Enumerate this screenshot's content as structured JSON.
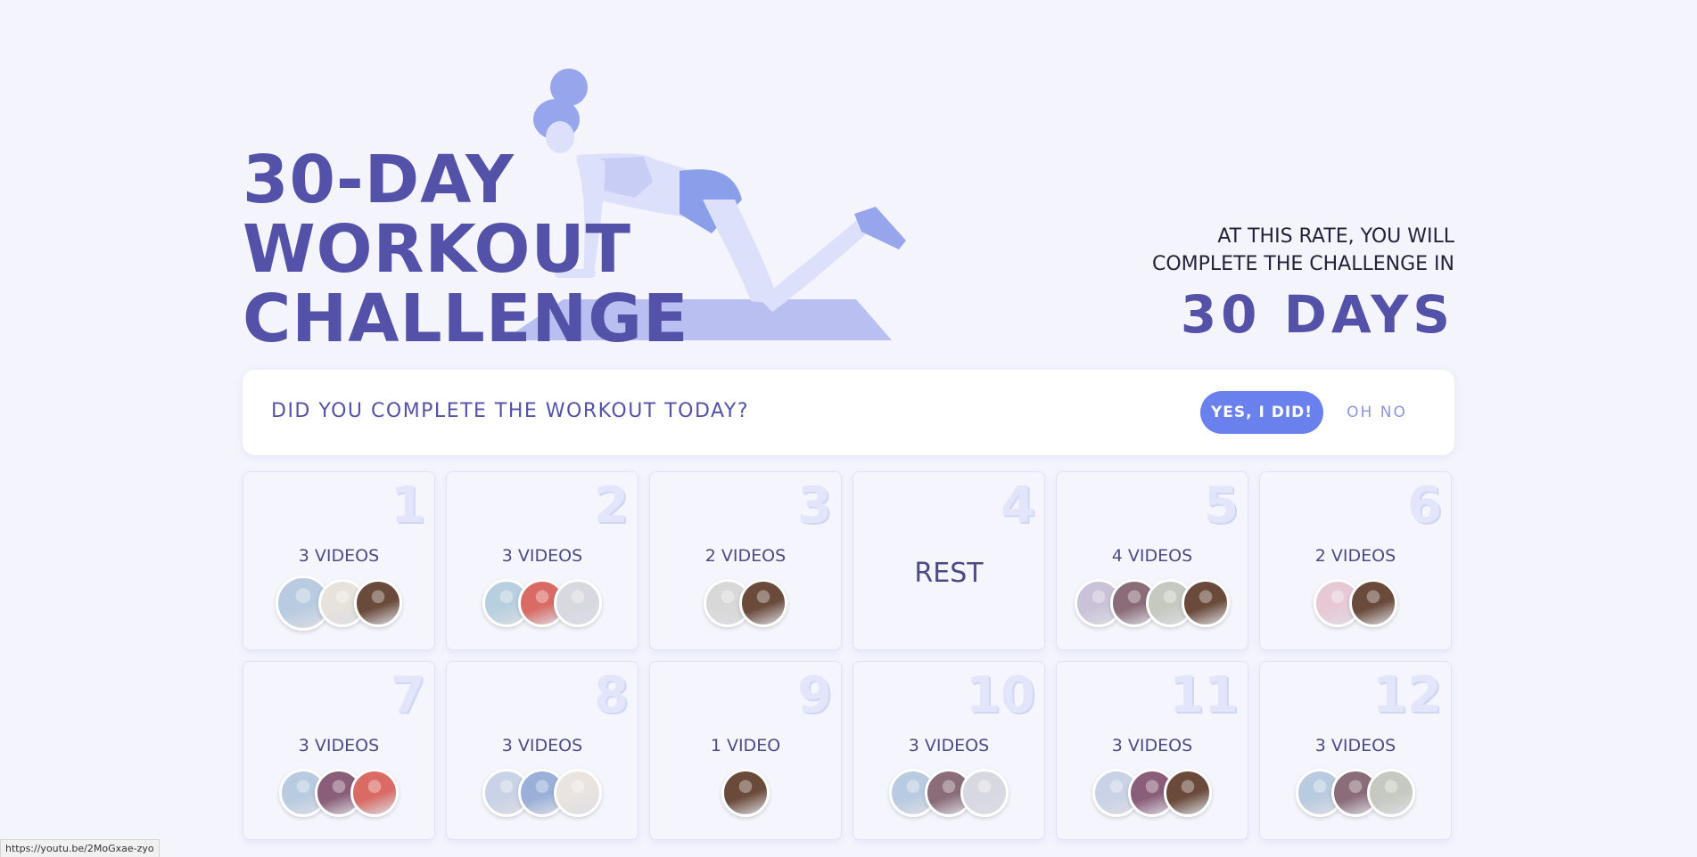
{
  "hero": {
    "title_lines": [
      "30-DAY",
      "WORKOUT",
      "CHALLENGE"
    ],
    "rate_line1": "AT THIS RATE, YOU WILL",
    "rate_line2": "COMPLETE THE CHALLENGE IN",
    "rate_days": "30 DAYS"
  },
  "question": {
    "text": "DID YOU COMPLETE THE WORKOUT TODAY?",
    "yes_label": "YES, I DID!",
    "no_label": "OH NO"
  },
  "days": [
    {
      "num": "1",
      "label": "3 VIDEOS",
      "thumbs": [
        "#b9cbe0",
        "#e8e2dc",
        "#6a4a3a"
      ]
    },
    {
      "num": "2",
      "label": "3 VIDEOS",
      "thumbs": [
        "#b8cfe0",
        "#d96a64",
        "#d8d8e0"
      ]
    },
    {
      "num": "3",
      "label": "2 VIDEOS",
      "thumbs": [
        "#d8d8d8",
        "#6a4a3a"
      ]
    },
    {
      "num": "4",
      "label": "REST",
      "thumbs": []
    },
    {
      "num": "5",
      "label": "4 VIDEOS",
      "thumbs": [
        "#c9c2d8",
        "#8a6d78",
        "#c6c9c0",
        "#6a4a3a"
      ]
    },
    {
      "num": "6",
      "label": "2 VIDEOS",
      "thumbs": [
        "#e7c9d6",
        "#6a4a3a"
      ]
    },
    {
      "num": "7",
      "label": "3 VIDEOS",
      "thumbs": [
        "#b9cbe0",
        "#8a5d78",
        "#d96a64"
      ]
    },
    {
      "num": "8",
      "label": "3 VIDEOS",
      "thumbs": [
        "#c9d2e6",
        "#9ab0d8",
        "#e9e4e0"
      ]
    },
    {
      "num": "9",
      "label": "1 VIDEO",
      "thumbs": [
        "#6a4a3a"
      ]
    },
    {
      "num": "10",
      "label": "3 VIDEOS",
      "thumbs": [
        "#b9cbe0",
        "#8a6d78",
        "#d8d8e0"
      ]
    },
    {
      "num": "11",
      "label": "3 VIDEOS",
      "thumbs": [
        "#c9d2e6",
        "#8a5d78",
        "#6a4a3a"
      ]
    },
    {
      "num": "12",
      "label": "3 VIDEOS",
      "thumbs": [
        "#b9cbe0",
        "#8a6d78",
        "#c6c9c0"
      ]
    }
  ],
  "status_bar": {
    "url": "https://youtu.be/2MoGxae-zyo"
  },
  "colors": {
    "accent": "#5452a8",
    "button": "#6a80ec",
    "background": "#f3f4fc"
  }
}
